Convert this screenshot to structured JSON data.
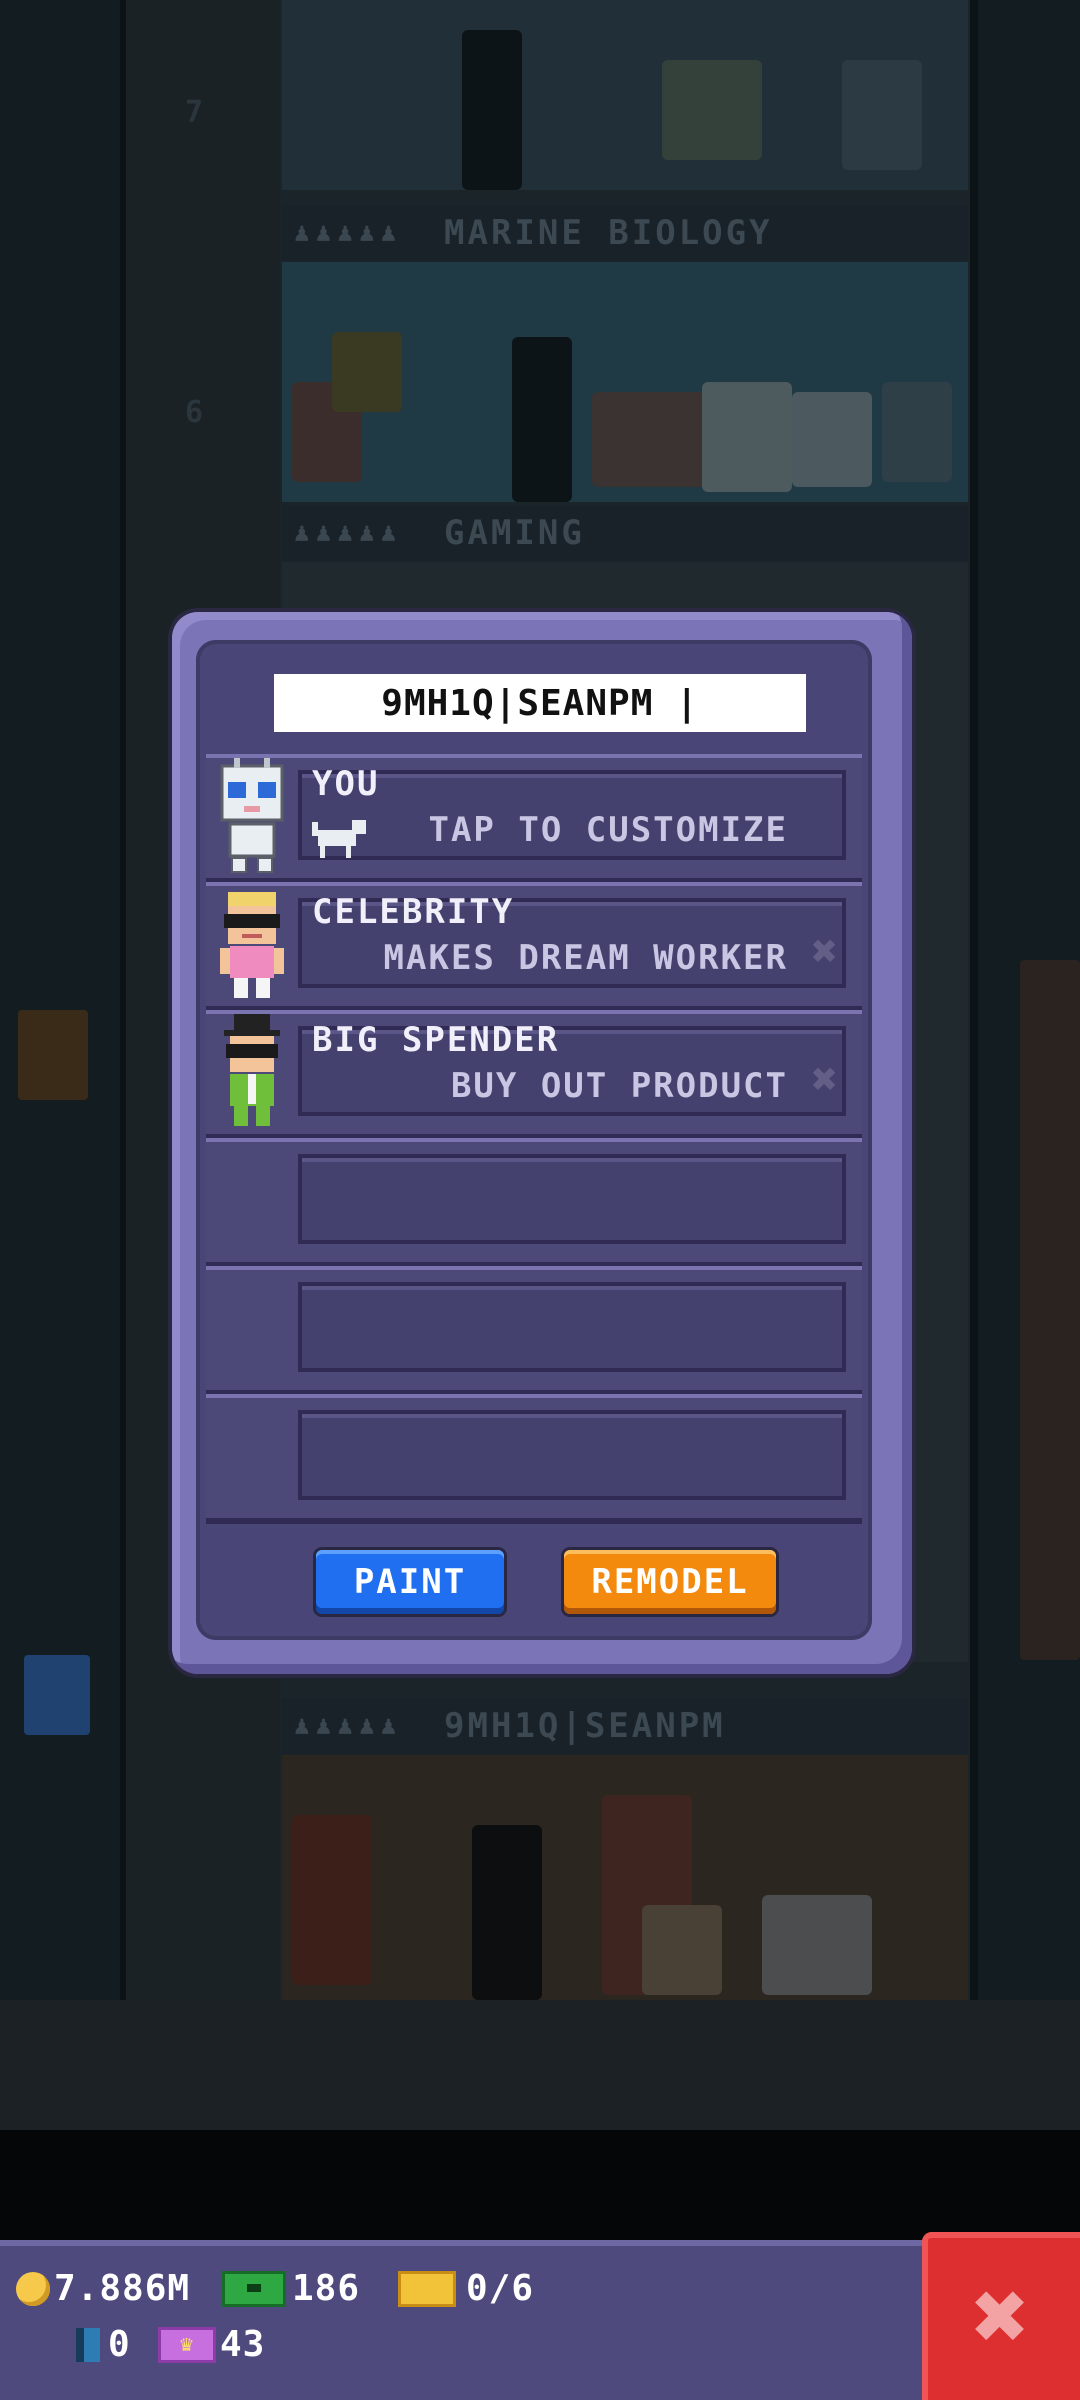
{
  "tower": {
    "floors": [
      {
        "label": "MARINE BIOLOGY"
      },
      {
        "label": "GAMING"
      },
      {
        "label": "9MH1Q|SEANPM"
      }
    ]
  },
  "dialog": {
    "tower_name": "9MH1Q|SEANPM |",
    "slots": [
      {
        "title": "YOU",
        "desc": "TAP TO CUSTOMIZE"
      },
      {
        "title": "CELEBRITY",
        "desc": "MAKES DREAM WORKER"
      },
      {
        "title": "BIG SPENDER",
        "desc": "BUY OUT PRODUCT"
      }
    ],
    "paint_label": "PAINT",
    "remodel_label": "REMODEL"
  },
  "hud": {
    "coins": "7.886M",
    "bux": "186",
    "tickets": "0/6",
    "keys": "0",
    "vip": "43"
  },
  "icons": {
    "coin": "coin-icon",
    "bux": "tower-bux-icon",
    "ticket": "golden-ticket-icon",
    "key": "key-icon",
    "vip": "vip-ticket-icon",
    "close": "close-icon"
  },
  "colors": {
    "paint_button": "#1f6ff0",
    "remodel_button": "#f38a0e",
    "close_button": "#dd2f2f",
    "dialog": "#7b74b6"
  }
}
